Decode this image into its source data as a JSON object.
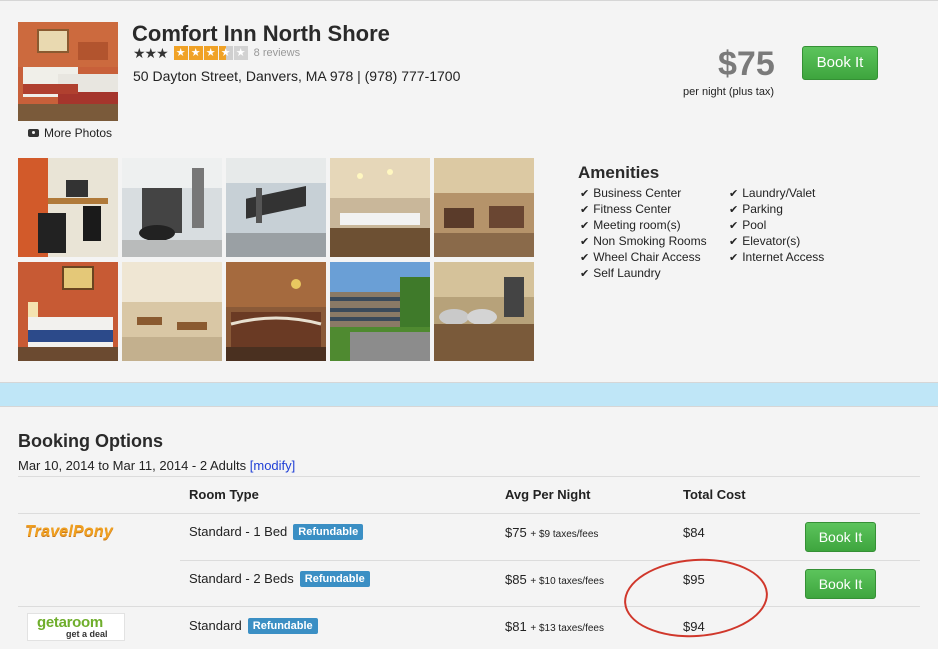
{
  "hotel": {
    "name": "Comfort Inn North Shore",
    "hotel_stars": "★★★",
    "review_rating": 3.5,
    "reviews": "8 reviews",
    "address": "50 Dayton Street, Danvers, MA 978 | (978) 777-1700",
    "more_photos": "More Photos",
    "price": "$75",
    "price_note": "per night (plus tax)",
    "book_label": "Book It"
  },
  "gallery": {
    "thumbs": [
      "business-center-photo",
      "fitness-bikes-photo",
      "fitness-treadmill-photo",
      "meeting-room-photo",
      "lobby-lounge-photo",
      "guest-room-photo",
      "breakfast-room-photo",
      "front-desk-photo",
      "exterior-photo",
      "breakfast-buffet-photo"
    ]
  },
  "amenities": {
    "title": "Amenities",
    "col1": [
      "Business Center",
      "Fitness Center",
      "Meeting room(s)",
      "Non Smoking Rooms",
      "Wheel Chair Access",
      "Self Laundry"
    ],
    "col2": [
      "Laundry/Valet",
      "Parking",
      "Pool",
      "Elevator(s)",
      "Internet Access"
    ]
  },
  "booking": {
    "title": "Booking Options",
    "dates": "Mar 10, 2014 to Mar 11, 2014 - 2 Adults",
    "modify": "[modify]",
    "headers": {
      "room_type": "Room Type",
      "avg": "Avg Per Night",
      "total": "Total Cost"
    },
    "providers": {
      "travelpony": "TravelPony",
      "getaroom_main": "getaroom",
      "getaroom_sub": "get a deal"
    },
    "rows": [
      {
        "room": "Standard - 1 Bed",
        "badge": "Refundable",
        "avg": "$75",
        "fee": "+ $9 taxes/fees",
        "total": "$84",
        "book": "Book It"
      },
      {
        "room": "Standard - 2 Beds",
        "badge": "Refundable",
        "avg": "$85",
        "fee": "+ $10 taxes/fees",
        "total": "$95",
        "book": "Book It"
      },
      {
        "room": "Standard",
        "badge": "Refundable",
        "avg": "$81",
        "fee": "+ $13 taxes/fees",
        "total": "$94"
      }
    ]
  },
  "colors": {
    "accent_green": "#3ea53e",
    "badge_blue": "#3b8fc4",
    "link_blue": "#1f3fd6",
    "highlight_red": "#d0372b",
    "star_orange": "#f0a226"
  }
}
